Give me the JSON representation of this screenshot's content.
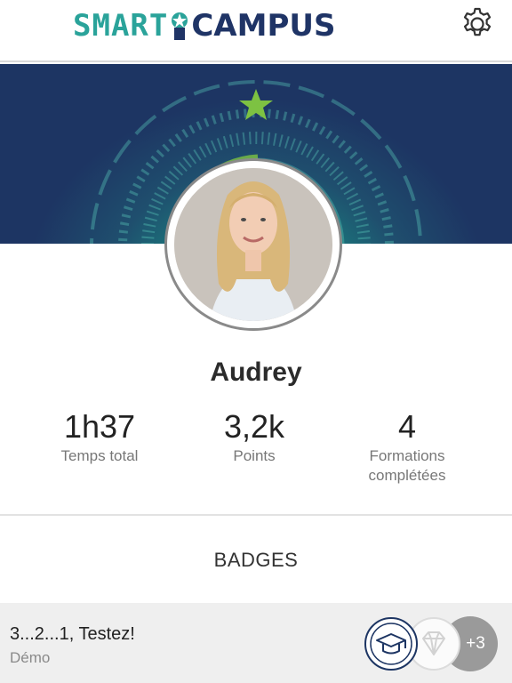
{
  "header": {
    "logo_text_left": "SMART",
    "logo_text_right": "CAMPUS",
    "settings_icon": "gear-icon"
  },
  "profile": {
    "name": "Audrey"
  },
  "stats": [
    {
      "value": "1h37",
      "label": "Temps total"
    },
    {
      "value": "3,2k",
      "label": "Points"
    },
    {
      "value": "4",
      "label": "Formations complétées"
    }
  ],
  "badges": {
    "title": "BADGES",
    "item": {
      "title": "3...2...1, Testez!",
      "subtitle": "Démo",
      "icons": [
        "graduation-cap-icon",
        "diamond-icon"
      ],
      "more": "+3"
    }
  },
  "colors": {
    "brand_teal": "#2aa39a",
    "brand_navy": "#1f3466",
    "star": "#7dc242"
  }
}
